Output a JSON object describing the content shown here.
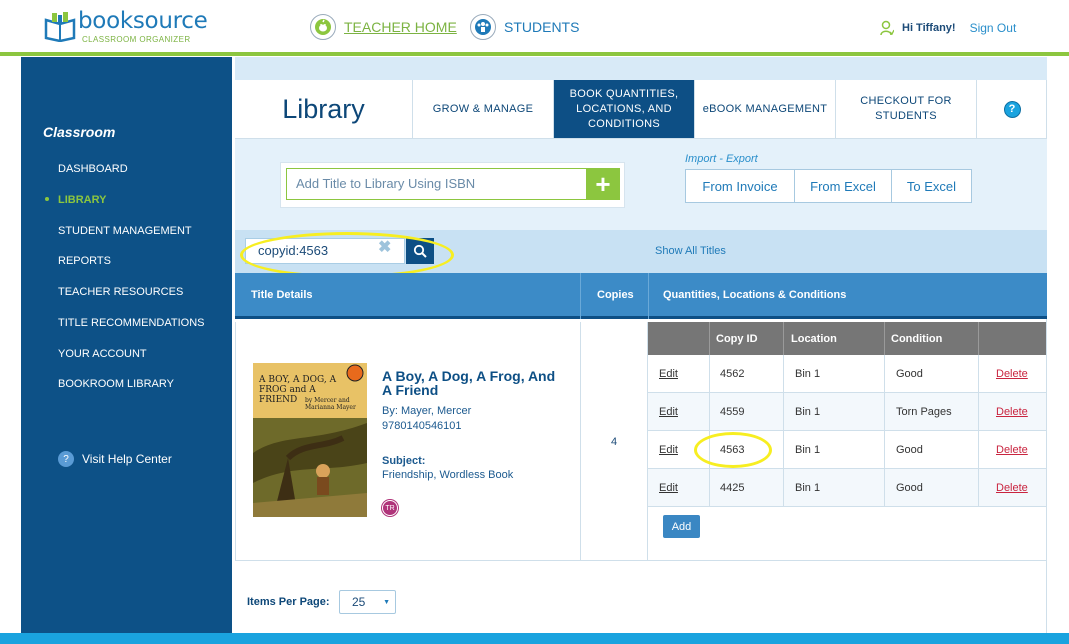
{
  "header": {
    "brand": "booksource",
    "brand_tag": "CLASSROOM ORGANIZER",
    "nav": [
      {
        "label": "TEACHER HOME",
        "icon": "apple-icon"
      },
      {
        "label": "STUDENTS",
        "icon": "students-icon"
      }
    ],
    "greeting": "Hi Tiffany!",
    "sign_out": "Sign Out"
  },
  "sidebar": {
    "title": "Classroom",
    "items": [
      {
        "label": "DASHBOARD",
        "active": false
      },
      {
        "label": "LIBRARY",
        "active": true
      },
      {
        "label": "STUDENT MANAGEMENT",
        "active": false
      },
      {
        "label": "REPORTS",
        "active": false
      },
      {
        "label": "TEACHER RESOURCES",
        "active": false
      },
      {
        "label": "TITLE RECOMMENDATIONS",
        "active": false
      },
      {
        "label": "YOUR ACCOUNT",
        "active": false
      },
      {
        "label": "BOOKROOM LIBRARY",
        "active": false
      }
    ],
    "help": "Visit Help Center"
  },
  "page": {
    "title": "Library",
    "tabs": [
      {
        "label": "GROW & MANAGE",
        "active": false
      },
      {
        "label": "BOOK QUANTITIES, LOCATIONS, AND CONDITIONS",
        "active": true
      },
      {
        "label": "eBOOK MANAGEMENT",
        "active": false
      },
      {
        "label": "CHECKOUT FOR STUDENTS",
        "active": false
      }
    ],
    "help_icon": "?"
  },
  "tools": {
    "isbn_placeholder": "Add Title to Library Using ISBN",
    "import_export_label": "Import - Export",
    "import_export_buttons": [
      "From Invoice",
      "From Excel",
      "To Excel"
    ]
  },
  "search": {
    "value": "copyid:4563",
    "show_all": "Show All Titles"
  },
  "table": {
    "headers": [
      "Title Details",
      "Copies",
      "Quantities, Locations & Conditions"
    ],
    "book": {
      "title": "A Boy, A Dog, A Frog, And A Friend",
      "by": "By: Mayer, Mercer",
      "isbn": "9780140546101",
      "subject_label": "Subject:",
      "subject": "Friendship, Wordless Book",
      "badge": "TR",
      "cover_title": "A BOY, A DOG, A FROG and A FRIEND",
      "cover_by": "by Mercer and Marianna Mayer",
      "copies": "4"
    },
    "copy_headers": [
      "Copy ID",
      "Location",
      "Condition"
    ],
    "copies": [
      {
        "edit": "Edit",
        "id": "4562",
        "location": "Bin 1",
        "condition": "Good",
        "delete": "Delete"
      },
      {
        "edit": "Edit",
        "id": "4559",
        "location": "Bin 1",
        "condition": "Torn Pages",
        "delete": "Delete"
      },
      {
        "edit": "Edit",
        "id": "4563",
        "location": "Bin 1",
        "condition": "Good",
        "delete": "Delete"
      },
      {
        "edit": "Edit",
        "id": "4425",
        "location": "Bin 1",
        "condition": "Good",
        "delete": "Delete"
      }
    ],
    "add_label": "Add"
  },
  "pagination": {
    "items_per_page_label": "Items Per Page:",
    "items_per_page": "25"
  },
  "colors": {
    "navy": "#0d5187",
    "green": "#8cc63f",
    "blue": "#3c8bc7",
    "highlight": "#f7ee21",
    "delete": "#c9243f"
  }
}
